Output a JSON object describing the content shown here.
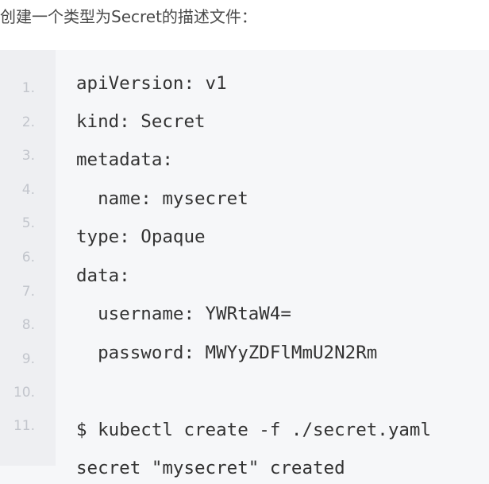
{
  "intro_text": "创建一个类型为Secret的描述文件：",
  "code": {
    "line_numbers": [
      "1.",
      "2.",
      "3.",
      "4.",
      "5.",
      "6.",
      "7.",
      "8.",
      "9.",
      "10.",
      "11."
    ],
    "lines": [
      "apiVersion: v1",
      "kind: Secret",
      "metadata:",
      "  name: mysecret",
      "type: Opaque",
      "data:",
      "  username: YWRtaW4=",
      "  password: MWYyZDFlMmU2N2Rm",
      "",
      "$ kubectl create -f ./secret.yaml",
      "secret \"mysecret\" created"
    ]
  }
}
